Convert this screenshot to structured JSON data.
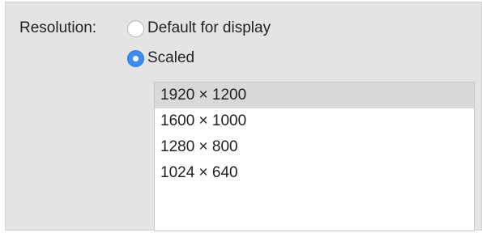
{
  "resolution": {
    "label": "Resolution:",
    "options": [
      {
        "label": "Default for display",
        "selected": false
      },
      {
        "label": "Scaled",
        "selected": true
      }
    ]
  },
  "scaled_list": {
    "items": [
      {
        "label": "1920 × 1200",
        "selected": true
      },
      {
        "label": "1600 × 1000",
        "selected": false
      },
      {
        "label": "1280 × 800",
        "selected": false
      },
      {
        "label": "1024 × 640",
        "selected": false
      }
    ]
  },
  "colors": {
    "accent": "#3d8cf0",
    "panel_bg": "#e4e4e4",
    "selected_row": "#d9d9d9"
  }
}
